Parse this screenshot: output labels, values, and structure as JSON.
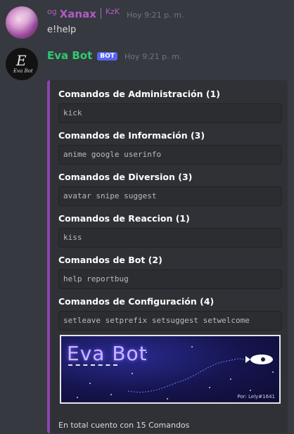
{
  "message1": {
    "prefix": "og",
    "username": "Xanax",
    "tag": "KzK",
    "timestamp": "Hoy 9:21 p. m.",
    "content": "e!help",
    "username_color": "#b05cc3"
  },
  "message2": {
    "username": "Eva Bot",
    "badge": "BOT",
    "timestamp": "Hoy 9:21 p. m.",
    "username_color": "#2ecc71",
    "avatar": {
      "letter": "E",
      "text": "Eva Bot"
    },
    "embed": {
      "accent_color": "#8e44ad",
      "fields": [
        {
          "title": "Comandos de Administración (1)",
          "value": "kick"
        },
        {
          "title": "Comandos de Información (3)",
          "value": "anime google userinfo"
        },
        {
          "title": "Comandos de Diversion (3)",
          "value": "avatar snipe suggest"
        },
        {
          "title": "Comandos de Reaccion (1)",
          "value": "kiss"
        },
        {
          "title": "Comandos de Bot (2)",
          "value": "help reportbug"
        },
        {
          "title": "Comandos de Configuración (4)",
          "value": "setleave setprefix setsuggest setwelcome"
        }
      ],
      "image": {
        "title": "Eva Bot",
        "byline": "Por: Lely#1641"
      },
      "footer": "En total cuento con 15 Comandos"
    }
  }
}
